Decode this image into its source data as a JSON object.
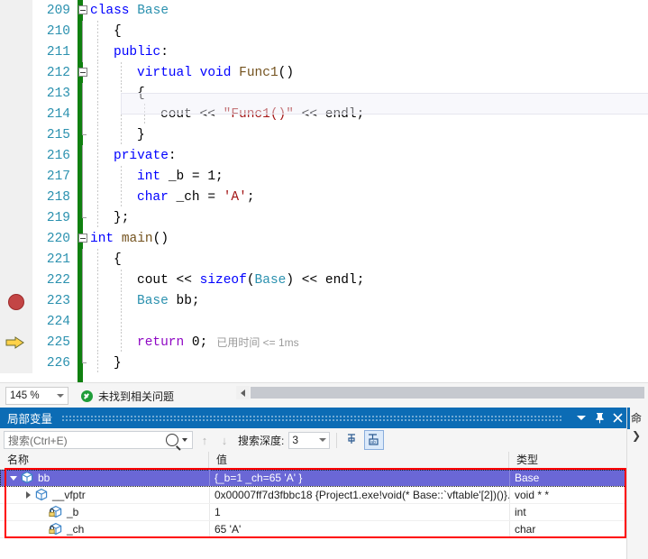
{
  "editor": {
    "lines": [
      {
        "num": "209",
        "fold": "open",
        "indent": 0,
        "text": "class Base"
      },
      {
        "num": "210",
        "fold": "none",
        "indent": 1,
        "text": "{"
      },
      {
        "num": "211",
        "fold": "none",
        "indent": 1,
        "text": "public:"
      },
      {
        "num": "212",
        "fold": "open",
        "indent": 2,
        "text": "virtual void Func1()"
      },
      {
        "num": "213",
        "fold": "none",
        "indent": 2,
        "text": "{"
      },
      {
        "num": "214",
        "fold": "none",
        "indent": 3,
        "text": "cout << \"Func1()\" << endl;"
      },
      {
        "num": "215",
        "fold": "end",
        "indent": 2,
        "text": "}"
      },
      {
        "num": "216",
        "fold": "none",
        "indent": 1,
        "text": "private:"
      },
      {
        "num": "217",
        "fold": "none",
        "indent": 2,
        "text": "int _b = 1;"
      },
      {
        "num": "218",
        "fold": "none",
        "indent": 2,
        "text": "char _ch = 'A';"
      },
      {
        "num": "219",
        "fold": "end",
        "indent": 1,
        "text": "};"
      },
      {
        "num": "220",
        "fold": "open",
        "indent": 0,
        "text": "int main()"
      },
      {
        "num": "221",
        "fold": "none",
        "indent": 1,
        "text": "{"
      },
      {
        "num": "222",
        "fold": "none",
        "indent": 2,
        "text": "cout << sizeof(Base) << endl;"
      },
      {
        "num": "223",
        "fold": "none",
        "indent": 2,
        "text": "Base bb;",
        "marker": "breakpoint"
      },
      {
        "num": "224",
        "fold": "none",
        "indent": 2,
        "text": ""
      },
      {
        "num": "225",
        "fold": "none",
        "indent": 2,
        "text": "return 0;",
        "marker": "current",
        "hint": "已用时间 <= 1ms"
      },
      {
        "num": "226",
        "fold": "end",
        "indent": 1,
        "text": "}"
      }
    ],
    "hint_text": "已用时间 <= 1ms"
  },
  "statusbar": {
    "zoom": "145 %",
    "analysis_message": "未找到相关问题"
  },
  "locals": {
    "title": "局部变量",
    "search_placeholder": "搜索(Ctrl+E)",
    "depth_label": "搜索深度:",
    "depth_value": "3",
    "columns": [
      "名称",
      "值",
      "类型"
    ],
    "rows": [
      {
        "name": "bb",
        "value": "{_b=1 _ch=65 'A' }",
        "type": "Base",
        "indent": 0,
        "twisty": "open",
        "icon": "variable-box-icon",
        "selected": true
      },
      {
        "name": "__vfptr",
        "value": "0x00007ff7d3fbbc18 {Project1.exe!void(* Base::`vftable'[2])()}...",
        "type": "void * *",
        "indent": 1,
        "twisty": "closed",
        "icon": "variable-box-icon",
        "selected": false
      },
      {
        "name": "_b",
        "value": "1",
        "type": "int",
        "indent": 2,
        "twisty": "none",
        "icon": "private-variable-icon",
        "pin": true,
        "selected": false
      },
      {
        "name": "_ch",
        "value": "65 'A'",
        "type": "char",
        "indent": 2,
        "twisty": "none",
        "icon": "private-variable-icon",
        "selected": false
      }
    ]
  },
  "right_panel": {
    "tab_label": "命",
    "chevron": "❯"
  },
  "colors": {
    "accent": "#0c6cb5",
    "selection": "#6a67d6",
    "highlight_box": "#ff0000",
    "keyword": "#0000ff",
    "type": "#2b91af",
    "string": "#a31515",
    "function": "#74531f",
    "changebar": "#108010",
    "breakpoint": "#c34545",
    "current_line_arrow": "#ffc700"
  }
}
